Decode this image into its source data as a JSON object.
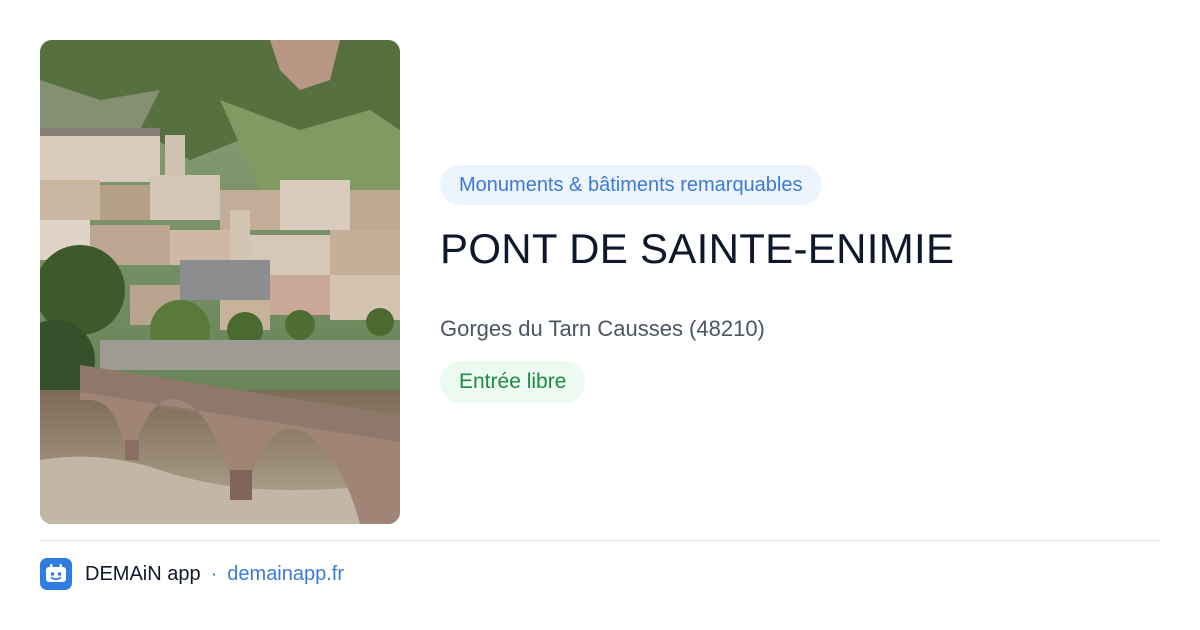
{
  "place": {
    "category": "Monuments & bâtiments remarquables",
    "title": "PONT DE SAINTE-ENIMIE",
    "location": "Gorges du Tarn Causses (48210)",
    "price": "Entrée libre"
  },
  "footer": {
    "brand": "DEMAiN app",
    "separator": "·",
    "link": "demainapp.fr"
  },
  "colors": {
    "accent": "#3a7bd5",
    "category_bg": "#eef4fd",
    "price_text": "#1e8a45",
    "price_bg": "#edfaf1"
  }
}
